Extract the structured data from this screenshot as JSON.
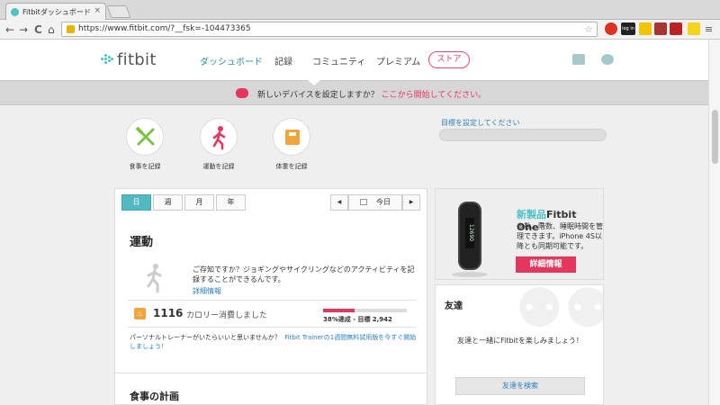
{
  "browser": {
    "tab_title": "Fitbitダッシュボード",
    "tab_close": "×",
    "url": "https://www.fitbit.com/?__fsk=-104473365",
    "back": "←",
    "forward": "→",
    "reload": "C",
    "home": "⌂",
    "star": "☆",
    "menu": "≡",
    "ext_login": "log in"
  },
  "site": {
    "logo": "fitbit",
    "nav": [
      "ダッシュボード",
      "記録",
      "コミュニティ",
      "プレミアム"
    ],
    "store": "ストア",
    "banner_text": "新しいデバイスを設定しますか？",
    "banner_link": "ここから開始してください。"
  },
  "shortcuts": [
    {
      "label": "食事を記録",
      "icon": "fork-knife-icon"
    },
    {
      "label": "運動を記録",
      "icon": "runner-icon"
    },
    {
      "label": "体重を記録",
      "icon": "scale-icon"
    }
  ],
  "goal": {
    "link": "目標を設定してください"
  },
  "period": {
    "buttons": [
      "日",
      "週",
      "月",
      "年"
    ],
    "active": "日",
    "today": "今日",
    "prev": "◀",
    "next": "▶"
  },
  "exercise": {
    "title": "運動",
    "info": "ご存知ですか？ジョギングやサイクリングなどのアクティビティを記録することができるんです。",
    "more": "詳細情報",
    "calories": "1116",
    "calories_label": "カロリー消費しました",
    "progress_pct": 38,
    "progress_label": "38%達成 - 目標",
    "goal_value": "2,942",
    "trainer_text": "パーソナルトレーナーがいたらいいと思いませんか？",
    "trainer_link": "Fitbit Trainerの1週間無料試用版を今すぐ開始しましょう！"
  },
  "food": {
    "title": "食事の計画"
  },
  "promo": {
    "title_new": "新製品",
    "title_product": "Fitbit One",
    "tm": "™",
    "desc": "歩数、階数、睡眠時間を管理できます。iPhone 4S以降とも同期可能です。",
    "button": "詳細情報",
    "screen": "12690"
  },
  "friends": {
    "title": "友達",
    "message": "友達と一緒にFitbitを楽しみましょう！",
    "button": "友達を検索"
  },
  "colors": {
    "accent": "#4cc2c4",
    "pink": "#e5365d",
    "link": "#2d7fc0",
    "green_icon": "#7dc242"
  }
}
